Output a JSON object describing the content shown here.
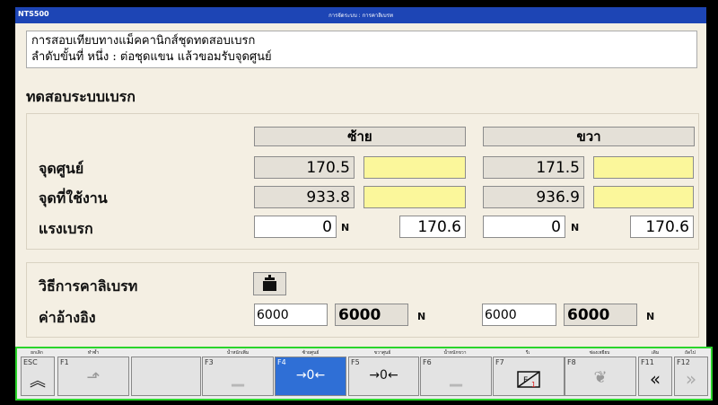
{
  "title_bar": {
    "app_name": "NTS500",
    "breadcrumb": "การจัดระบบ : การคาลิเบรท"
  },
  "instructions": {
    "line1": "การสอบเทียบทางแม็คคานิกส์ชุดทดสอบเบรก",
    "line2": "ลำดับขั้นที่ หนึ่ง : ต่อชุดแขน แล้วขอมรับจุดศูนย์"
  },
  "section_title": "ทดสอบระบบเบรก",
  "columns": {
    "left": "ซ้าย",
    "right": "ขวา"
  },
  "rows": {
    "zero_point": {
      "label": "จุดศูนย์",
      "left_value": "170.5",
      "right_value": "171.5"
    },
    "working_point": {
      "label": "จุดที่ใช้งาน",
      "left_value": "933.8",
      "right_value": "936.9"
    },
    "brake_force": {
      "label": "แรงเบรก",
      "left_value": "0",
      "left_unit": "N",
      "left_ref": "170.6",
      "right_value": "0",
      "right_unit": "N",
      "right_ref": "170.6"
    }
  },
  "calibration": {
    "method_label": "วิธีการคาลิเบรท",
    "reference_label": "ค่าอ้างอิง",
    "left_input": "6000",
    "left_value": "6000",
    "left_unit": "N",
    "right_input": "6000",
    "right_value": "6000",
    "right_unit": "N",
    "method_icon": "weight-icon"
  },
  "function_bar": {
    "keys": [
      {
        "key": "ESC",
        "caption": "ยกเลิก",
        "icon": "double-chevron-up-icon"
      },
      {
        "key": "F1",
        "caption": "ทำซ้ำ",
        "icon": "repeat-icon"
      },
      {
        "key": "",
        "caption": "",
        "icon": ""
      },
      {
        "key": "F3",
        "caption": "น้ำหนักเพิ่ม",
        "icon": "weight-icon"
      },
      {
        "key": "F4",
        "caption": "ซ้ายศูนย์",
        "icon": "zero-arrows-icon"
      },
      {
        "key": "F5",
        "caption": "ขวาศูนย์",
        "icon": "zero-arrows-icon"
      },
      {
        "key": "F6",
        "caption": "น้ำหนักขวา",
        "icon": "weight-icon"
      },
      {
        "key": "F7",
        "caption": "รีเ",
        "icon": "function-icon"
      },
      {
        "key": "F8",
        "caption": "ช่องเหยียบ",
        "icon": "pedal-icon"
      },
      {
        "key": "F11",
        "caption": "เดิม",
        "icon": "double-chevron-left-icon"
      },
      {
        "key": "F12",
        "caption": "ถัดไป",
        "icon": "double-chevron-right-icon"
      }
    ]
  },
  "colors": {
    "title_bar": "#1d45b5",
    "highlight": "#fbf79b",
    "active_key": "#2f6fd6",
    "frame": "#2bd42b"
  }
}
